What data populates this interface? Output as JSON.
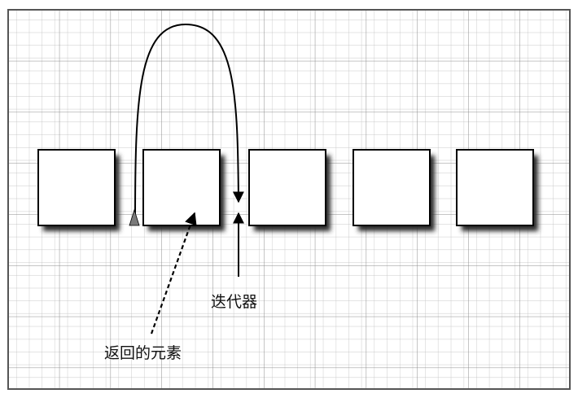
{
  "diagram": {
    "elements": [
      "box-1",
      "box-2",
      "box-3",
      "box-4",
      "box-5"
    ],
    "labels": {
      "iterator": "迭代器",
      "returned_element": "返回的元素"
    }
  },
  "colors": {
    "grid": "#9a9a9a",
    "box_fill": "#ffffff",
    "box_stroke": "#000000",
    "shadow": "#2a2a2a",
    "arrow": "#000000",
    "start_marker": "#8a8a8a"
  }
}
